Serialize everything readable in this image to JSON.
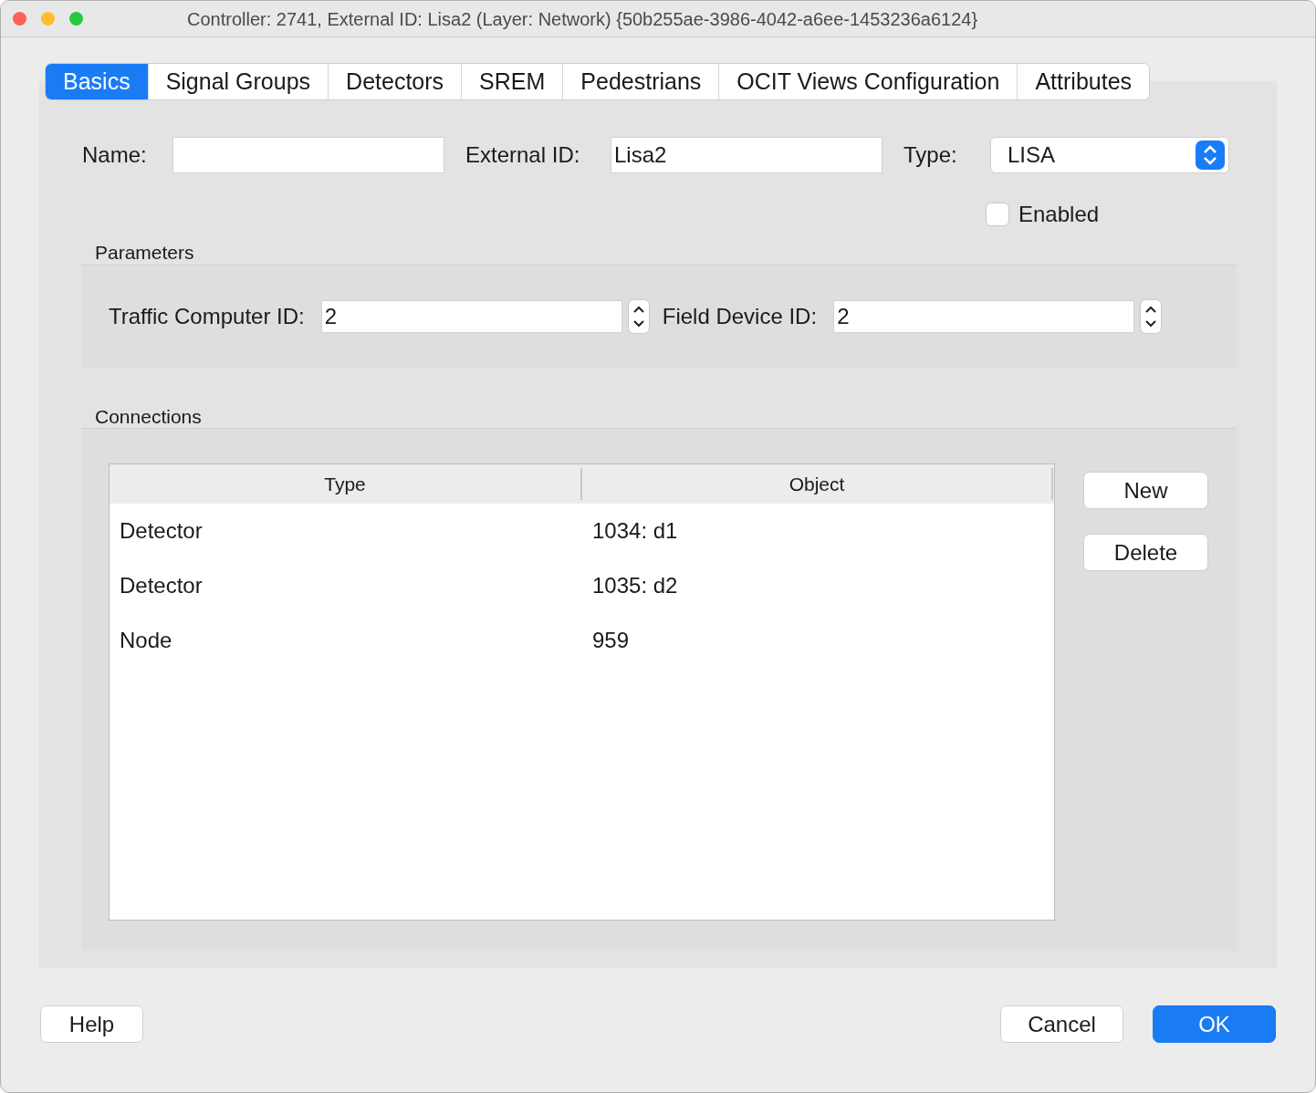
{
  "window": {
    "title": "Controller: 2741, External ID: Lisa2 (Layer: Network) {50b255ae-3986-4042-a6ee-1453236a6124}"
  },
  "tabs": [
    {
      "label": "Basics",
      "selected": true
    },
    {
      "label": "Signal Groups",
      "selected": false
    },
    {
      "label": "Detectors",
      "selected": false
    },
    {
      "label": "SREM",
      "selected": false
    },
    {
      "label": "Pedestrians",
      "selected": false
    },
    {
      "label": "OCIT Views Configuration",
      "selected": false
    },
    {
      "label": "Attributes",
      "selected": false
    }
  ],
  "basics": {
    "name": {
      "label": "Name:"
    },
    "external_id": {
      "label": "External ID:",
      "value": "Lisa2"
    },
    "type": {
      "label": "Type:",
      "value": "LISA"
    },
    "enabled": {
      "label": "Enabled",
      "checked": false
    }
  },
  "parameters": {
    "title": "Parameters",
    "fields": [
      {
        "label": "Traffic Computer ID:",
        "value": "2"
      },
      {
        "label": "Field Device ID:",
        "value": "2"
      }
    ]
  },
  "connections": {
    "title": "Connections",
    "table": {
      "columns": [
        "Type",
        "Object"
      ],
      "rows": [
        [
          "Detector",
          "1034: d1"
        ],
        [
          "Detector",
          "1035: d2"
        ],
        [
          "Node",
          "959"
        ]
      ]
    },
    "buttons": [
      "New",
      "Delete"
    ]
  },
  "footer": {
    "help": "Help",
    "buttons": [
      {
        "label": "Cancel",
        "kind": "normal"
      },
      {
        "label": "OK",
        "kind": "default"
      }
    ]
  }
}
